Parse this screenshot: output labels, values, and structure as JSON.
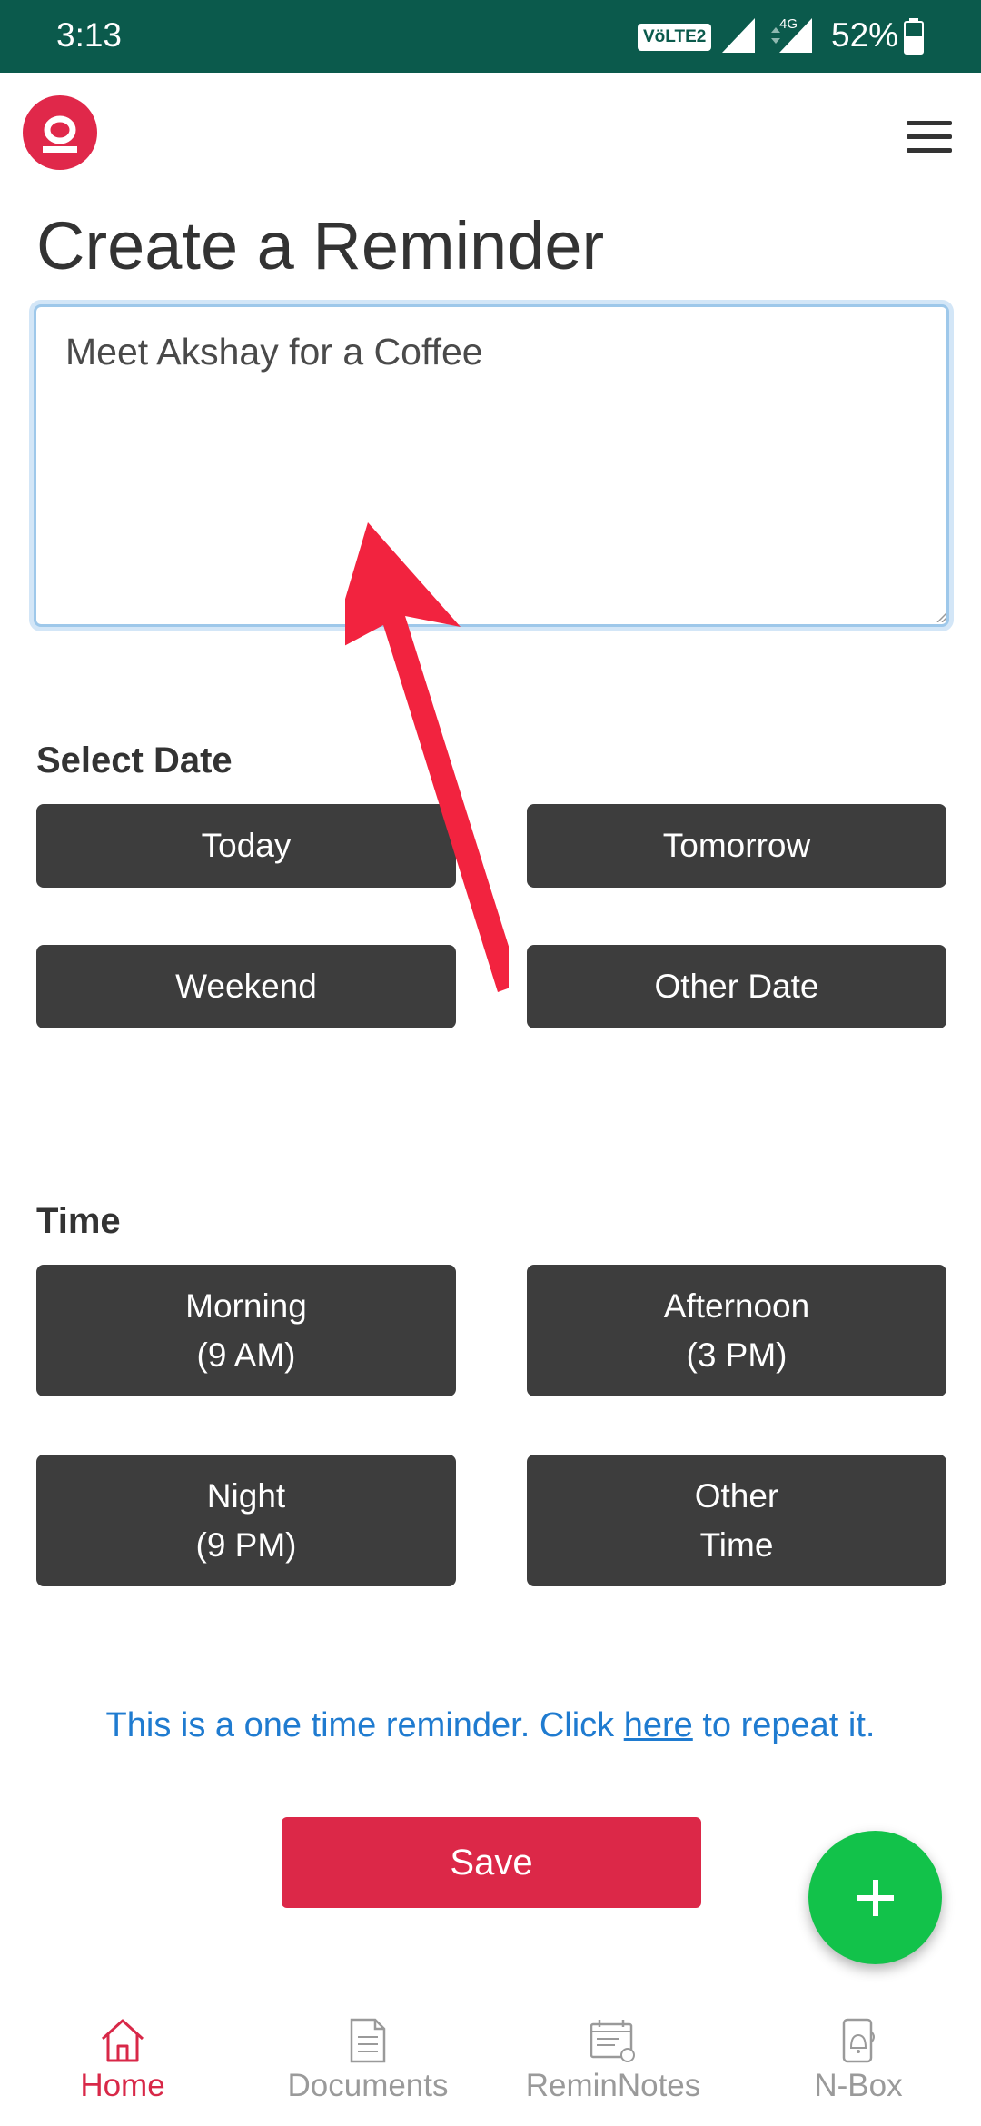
{
  "status_bar": {
    "time": "3:13",
    "volte_badge": "VöLTE2",
    "network": "4G",
    "battery": "52%"
  },
  "header": {
    "logo_icon": "app-logo-icon",
    "menu_icon": "hamburger-menu-icon"
  },
  "page": {
    "title": "Create a Reminder"
  },
  "reminder": {
    "text": "Meet Akshay for a Coffee"
  },
  "date_section": {
    "label": "Select Date",
    "options": [
      "Today",
      "Tomorrow",
      "Weekend",
      "Other Date"
    ]
  },
  "time_section": {
    "label": "Time",
    "options": [
      {
        "line1": "Morning",
        "line2": "(9 AM)"
      },
      {
        "line1": "Afternoon",
        "line2": "(3 PM)"
      },
      {
        "line1": "Night",
        "line2": "(9 PM)"
      },
      {
        "line1": "Other",
        "line2": "Time"
      }
    ]
  },
  "repeat_note": {
    "prefix": "This is a one time reminder. Click ",
    "link": "here",
    "suffix": " to repeat it."
  },
  "actions": {
    "save_label": "Save",
    "fab_icon": "plus-icon"
  },
  "bottom_nav": [
    {
      "label": "Home",
      "icon": "home-icon",
      "active": true
    },
    {
      "label": "Documents",
      "icon": "document-icon",
      "active": false
    },
    {
      "label": "ReminNotes",
      "icon": "reminotes-icon",
      "active": false
    },
    {
      "label": "N-Box",
      "icon": "nbox-icon",
      "active": false
    }
  ],
  "colors": {
    "status_bar": "#0b5a4c",
    "accent": "#dc2848",
    "button_dark": "#3d3d3d",
    "link": "#1f7bd0",
    "fab": "#12c24a",
    "annotation_arrow": "#f2233f"
  }
}
